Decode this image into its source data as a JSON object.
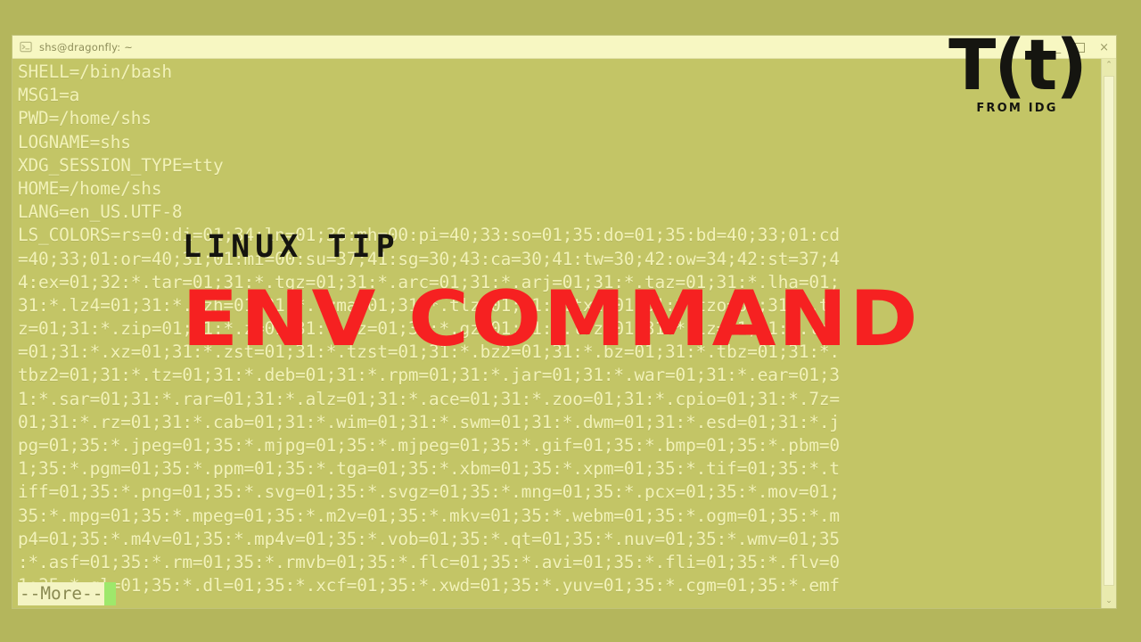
{
  "window": {
    "title": "shs@dragonfly: ~",
    "title_icon": "terminal-icon",
    "controls": {
      "minimize": "_",
      "maximize": "□",
      "close": "×"
    }
  },
  "terminal": {
    "lines": [
      "SHELL=/bin/bash",
      "MSG1=a",
      "PWD=/home/shs",
      "LOGNAME=shs",
      "XDG_SESSION_TYPE=tty",
      "HOME=/home/shs",
      "LANG=en_US.UTF-8",
      "LS_COLORS=rs=0:di=01;34:ln=01;36:mh=00:pi=40;33:so=01;35:do=01;35:bd=40;33;01:cd",
      "=40;33;01:or=40;31;01:mi=00:su=37;41:sg=30;43:ca=30;41:tw=30;42:ow=34;42:st=37;4",
      "4:ex=01;32:*.tar=01;31:*.tgz=01;31:*.arc=01;31:*.arj=01;31:*.taz=01;31:*.lha=01;",
      "31:*.lz4=01;31:*.lzh=01;31:*.lzma=01;31:*.tlz=01;31:*.txz=01;31:*.tzo=01;31:*.t7",
      "z=01;31:*.zip=01;31:*.z=01;31:*.dz=01;31:*.gz=01;31:*.lrz=01;31:*.lz=01;31:*.lzo",
      "=01;31:*.xz=01;31:*.zst=01;31:*.tzst=01;31:*.bz2=01;31:*.bz=01;31:*.tbz=01;31:*.",
      "tbz2=01;31:*.tz=01;31:*.deb=01;31:*.rpm=01;31:*.jar=01;31:*.war=01;31:*.ear=01;3",
      "1:*.sar=01;31:*.rar=01;31:*.alz=01;31:*.ace=01;31:*.zoo=01;31:*.cpio=01;31:*.7z=",
      "01;31:*.rz=01;31:*.cab=01;31:*.wim=01;31:*.swm=01;31:*.dwm=01;31:*.esd=01;31:*.j",
      "pg=01;35:*.jpeg=01;35:*.mjpg=01;35:*.mjpeg=01;35:*.gif=01;35:*.bmp=01;35:*.pbm=0",
      "1;35:*.pgm=01;35:*.ppm=01;35:*.tga=01;35:*.xbm=01;35:*.xpm=01;35:*.tif=01;35:*.t",
      "iff=01;35:*.png=01;35:*.svg=01;35:*.svgz=01;35:*.mng=01;35:*.pcx=01;35:*.mov=01;",
      "35:*.mpg=01;35:*.mpeg=01;35:*.m2v=01;35:*.mkv=01;35:*.webm=01;35:*.ogm=01;35:*.m",
      "p4=01;35:*.m4v=01;35:*.mp4v=01;35:*.vob=01;35:*.qt=01;35:*.nuv=01;35:*.wmv=01;35",
      ":*.asf=01;35:*.rm=01;35:*.rmvb=01;35:*.flc=01;35:*.avi=01;35:*.fli=01;35:*.flv=0",
      "1;35:*.gl=01;35:*.dl=01;35:*.xcf=01;35:*.xwd=01;35:*.yuv=01;35:*.cgm=01;35:*.emf"
    ],
    "more_prompt": "--More--"
  },
  "scrollbar": {
    "up_arrow": "⌃",
    "down_arrow": "⌄"
  },
  "overlay": {
    "kicker": "LINUX TIP",
    "headline": "ENV COMMAND"
  },
  "logo": {
    "mark": "T(t)",
    "sub": "FROM IDG"
  },
  "colors": {
    "page_background": "#b4b65c",
    "terminal_background": "#c3c566",
    "terminal_text": "#f2f2b8",
    "title_bar": "#f7f7c2",
    "headline_red": "#f62121",
    "kicker_black": "#15140f",
    "cursor_green": "#9ee86b",
    "scrollbar_track": "#e9eaae"
  }
}
